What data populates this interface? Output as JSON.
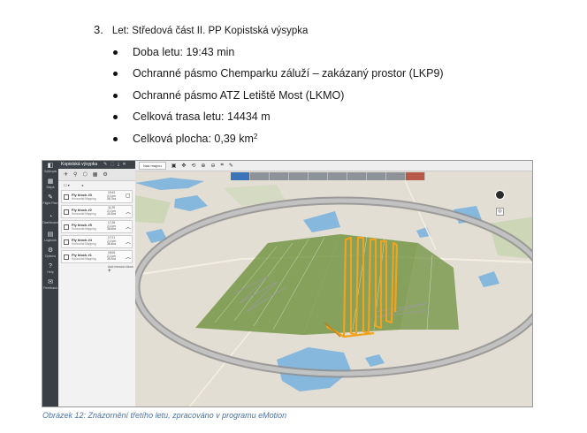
{
  "heading": {
    "number": "3.",
    "text": "Let: Středová část II. PP Kopistská výsypka"
  },
  "bullets": [
    {
      "text": "Doba letu: 19:43 min"
    },
    {
      "text": "Ochranné pásmo Chemparku záluží – zakázaný prostor (LKP9)"
    },
    {
      "text": "Ochranné pásmo ATZ Letiště Most (LKMO)"
    },
    {
      "text": "Celková trasa letu: 14434 m"
    },
    {
      "text": "Celková plocha: 0,39 km",
      "sup": "2"
    }
  ],
  "screenshot": {
    "panel_title": "Kopistská výsypka",
    "rail_items": [
      "Výškopis",
      "Mapa",
      "Flight Plan",
      "Dashboard",
      "Logbook",
      "Options",
      "Help",
      "Feedback"
    ],
    "blocks": [
      {
        "name": "Fly block #3",
        "sub": "Horizontal Mapping",
        "time": "19:43\n2.1 km\n36.7ha"
      },
      {
        "name": "Fly block #2",
        "sub": "Horizontal Mapping",
        "time": "11:29\n2.1 km\n40.2ha"
      },
      {
        "name": "Fly block #5",
        "sub": "Horizontal Mapping",
        "time": "17:28\n2.1 km\n38.6ha"
      },
      {
        "name": "Fly block #4",
        "sub": "Horizontal Mapping",
        "time": "17:21\n2.1 km\n36.4ha"
      },
      {
        "name": "Fly block #1",
        "sub": "Horizontal Mapping",
        "time": "18:08\n2.1 km\n39.2ha"
      }
    ],
    "add_block": "Add mission block",
    "map_select": "Nad mapou",
    "colors": {
      "area": "#6b8f3a",
      "track": "#f2a21d",
      "panel_dark": "#3a3f45",
      "tab_active": "#3b73b9"
    }
  },
  "caption": "Obrázek 12: Znázornění třetího letu, zpracováno v programu eMotion"
}
